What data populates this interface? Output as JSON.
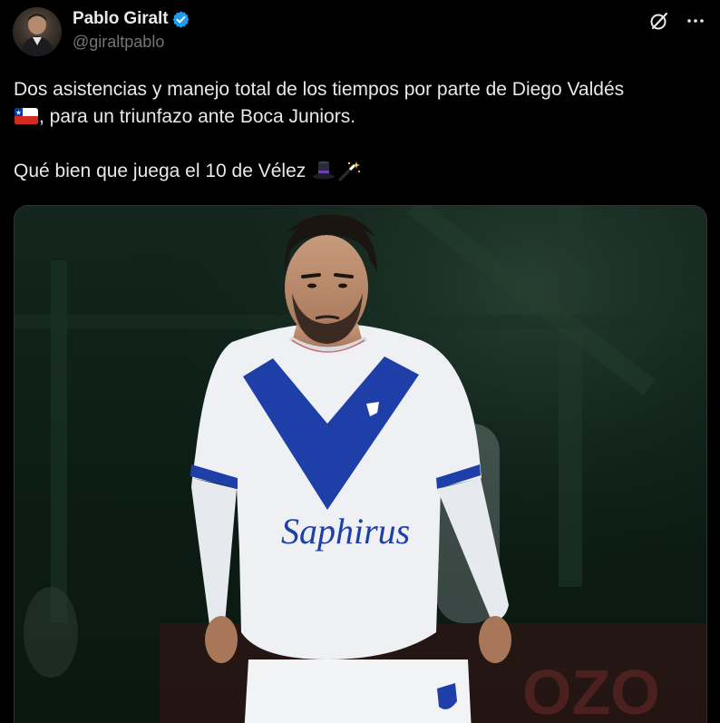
{
  "author": {
    "display_name": "Pablo Giralt",
    "handle": "@giraltpablo",
    "verified": true,
    "avatar_icon": "profile-photo"
  },
  "actions": {
    "grok_icon": "grok-icon",
    "more_icon": "more-icon"
  },
  "tweet": {
    "line1": "Dos asistencias y manejo total de los tiempos por parte de Diego Valdés",
    "line2": ", para un triunfazo ante Boca Juniors.",
    "line3": "Qué bien que juega el 10 de Vélez",
    "emoji_flag": "chile-flag",
    "emoji_hat": "top-hat",
    "emoji_wand": "magic-wand"
  },
  "media": {
    "type": "photo",
    "sponsor_text": "Saphirus"
  },
  "colors": {
    "background": "#000000",
    "text": "#e7e9ea",
    "muted": "#71767b",
    "verified_blue": "#1d9bf0",
    "kit_blue": "#1f3fa8"
  }
}
